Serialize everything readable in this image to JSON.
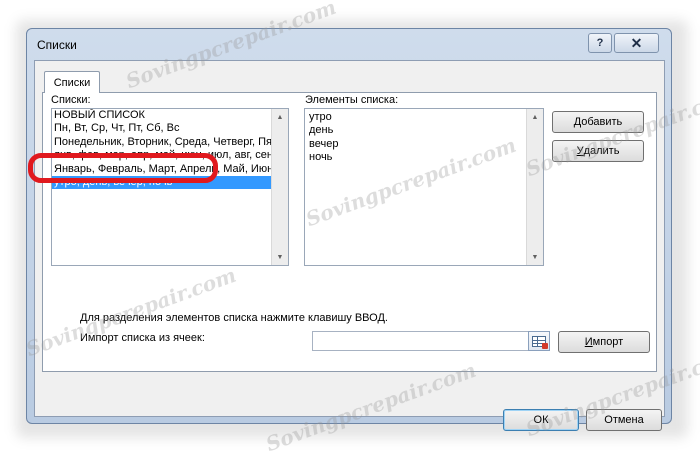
{
  "window": {
    "title": "Списки"
  },
  "titlebar": {
    "help_label": "?",
    "close_label": "✕"
  },
  "tabs": [
    {
      "label": "Списки"
    }
  ],
  "lists_panel": {
    "label": "Списки:",
    "items": [
      "НОВЫЙ СПИСОК",
      "Пн, Вт, Ср, Чт, Пт, Сб, Вс",
      "Понедельник, Вторник, Среда, Четверг, Пятница, Суббота, Воскресенье",
      "янв, фев, мар, апр, май, июн, июл, авг, сен, окт, ноя, дек",
      "Январь, Февраль, Март, Апрель, Май, Июнь, Июль, Август, Сентябрь, Октябрь, Ноябрь, Декабрь",
      "утро, день, вечер, ночь"
    ],
    "selected_index": 5
  },
  "elements_panel": {
    "label": "Элементы списка:",
    "items": [
      "утро",
      "день",
      "вечер",
      "ночь"
    ]
  },
  "buttons": {
    "add": {
      "underline": "Д",
      "rest": "обавить"
    },
    "delete": {
      "underline": "У",
      "rest": "далить"
    },
    "import": {
      "underline": "И",
      "rest": "мпорт"
    },
    "ok": "ОК",
    "cancel": "Отмена"
  },
  "hint_text": "Для разделения элементов списка нажмите клавишу ВВОД.",
  "import_label": "Импорт списка из ячеек:",
  "import_range": {
    "value": ""
  },
  "icons": {
    "help": "help-icon",
    "close": "close-icon",
    "range_select": "range-select-icon",
    "scroll_up": "scroll-up-arrow-icon",
    "scroll_down": "scroll-down-arrow-icon"
  },
  "watermark_text": "Sovingpcrepair.com",
  "colors": {
    "selection": "#3399ff",
    "highlight_ring": "#e0191e"
  }
}
